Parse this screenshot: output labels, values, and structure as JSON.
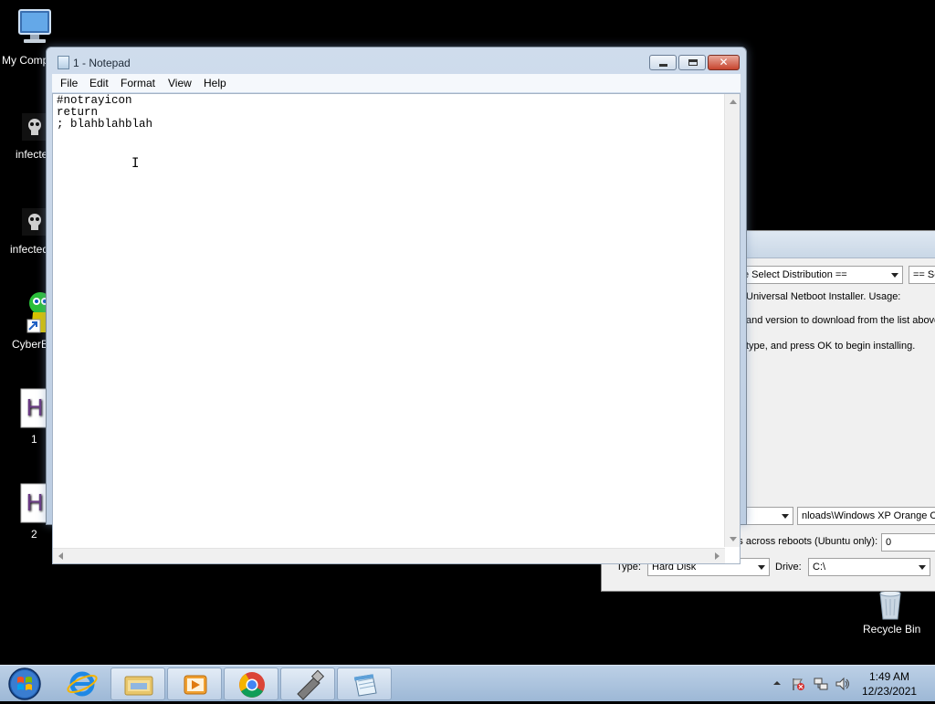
{
  "desktop": {
    "icons": [
      {
        "label": "My Comp"
      },
      {
        "label": "infecte"
      },
      {
        "label": "infected"
      },
      {
        "label": "CyberB"
      },
      {
        "label": "1"
      },
      {
        "label": "2"
      },
      {
        "label": "Recycle Bin"
      }
    ]
  },
  "installer": {
    "distribution_select": "e Select Distribution ==",
    "version_select": "== Se",
    "intro_line": "Universal Netboot Installer. Usage:",
    "line2": "and version to download from the list above",
    "line3": "type, and press OK to begin installing.",
    "diskimage_path": "nloads\\Windows XP Orange Co",
    "preserve_label": "Space used to preserve files across reboots (Ubuntu only):",
    "preserve_value": "0",
    "type_label": "Type:",
    "type_value": "Hard Disk",
    "drive_label": "Drive:",
    "drive_value": "C:\\"
  },
  "notepad": {
    "title": "1 - Notepad",
    "menu": [
      "File",
      "Edit",
      "Format",
      "View",
      "Help"
    ],
    "content": "#notrayicon\nreturn\n; blahblahblah"
  },
  "taskbar": {
    "pinned": [
      "start-orb-icon",
      "internet-explorer-icon",
      "windows-explorer-icon",
      "media-player-icon",
      "chrome-icon",
      "usb-tool-icon",
      "notepad-icon"
    ],
    "clock_time": "1:49 AM",
    "clock_date": "12/23/2021"
  }
}
